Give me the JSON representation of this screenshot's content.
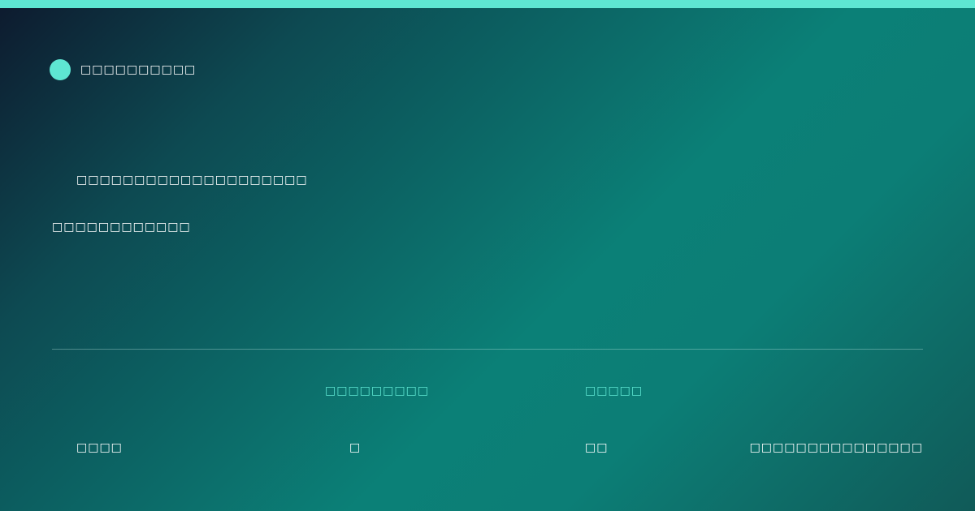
{
  "colors": {
    "accent": "#5ee6d2",
    "background_dark": "#0d1a2e",
    "background_teal": "#0b8077",
    "text": "#ffffff"
  },
  "brand": {
    "icon": "circle-logo-icon",
    "name": "□□□□□□□□□□"
  },
  "hero": {
    "headline": "□□□□□□□□□□□□□□□□□□□□",
    "subline": "□□□□□□□□□□□□"
  },
  "stats": {
    "col_a_value": "□□□□",
    "col_b_label": "□□□□□□□□□",
    "col_b_value": "□",
    "col_c_label": "□□□□□",
    "col_c_value": "□□",
    "col_d_value": "□□□□□□□□□□□□□□□"
  }
}
